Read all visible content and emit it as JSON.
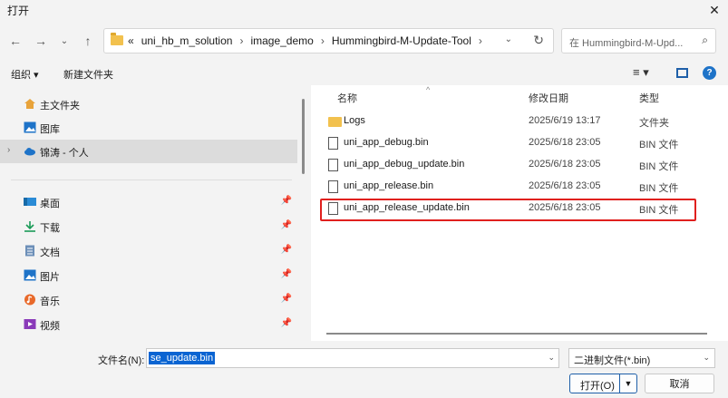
{
  "window": {
    "title": "打开",
    "close_icon": "close-icon"
  },
  "nav": {
    "breadcrumb_prefix": "«",
    "crumbs": [
      "uni_hb_m_solution",
      "image_demo",
      "Hummingbird-M-Update-Tool"
    ],
    "search_placeholder": "在 Hummingbird-M-Upd...",
    "search_icon": "search-icon"
  },
  "toolbar": {
    "organize": "组织 ▾",
    "new_folder": "新建文件夹"
  },
  "sidebar": {
    "top_items": [
      {
        "label": "主文件夹",
        "icon": "home-icon"
      },
      {
        "label": "图库",
        "icon": "gallery-icon"
      },
      {
        "label": "锦涛 - 个人",
        "icon": "cloud-icon",
        "selected": true
      }
    ],
    "pinned_items": [
      {
        "label": "桌面",
        "icon": "desktop-icon"
      },
      {
        "label": "下载",
        "icon": "download-icon"
      },
      {
        "label": "文档",
        "icon": "document-icon"
      },
      {
        "label": "图片",
        "icon": "pictures-icon"
      },
      {
        "label": "音乐",
        "icon": "music-icon"
      },
      {
        "label": "视频",
        "icon": "video-icon"
      }
    ]
  },
  "columns": {
    "name": "名称",
    "date": "修改日期",
    "type": "类型"
  },
  "files": [
    {
      "name": "Logs",
      "date": "2025/6/19 13:17",
      "type": "文件夹",
      "kind": "folder"
    },
    {
      "name": "uni_app_debug.bin",
      "date": "2025/6/18 23:05",
      "type": "BIN 文件",
      "kind": "file"
    },
    {
      "name": "uni_app_debug_update.bin",
      "date": "2025/6/18 23:05",
      "type": "BIN 文件",
      "kind": "file"
    },
    {
      "name": "uni_app_release.bin",
      "date": "2025/6/18 23:05",
      "type": "BIN 文件",
      "kind": "file"
    },
    {
      "name": "uni_app_release_update.bin",
      "date": "2025/6/18 23:05",
      "type": "BIN 文件",
      "kind": "file"
    }
  ],
  "highlight_color": "#e0201e",
  "bottom": {
    "filename_label": "文件名(N):",
    "filename_value": "se_update.bin",
    "filetype": "二进制文件(*.bin)",
    "open_label": "打开(O)",
    "cancel_label": "取消"
  }
}
